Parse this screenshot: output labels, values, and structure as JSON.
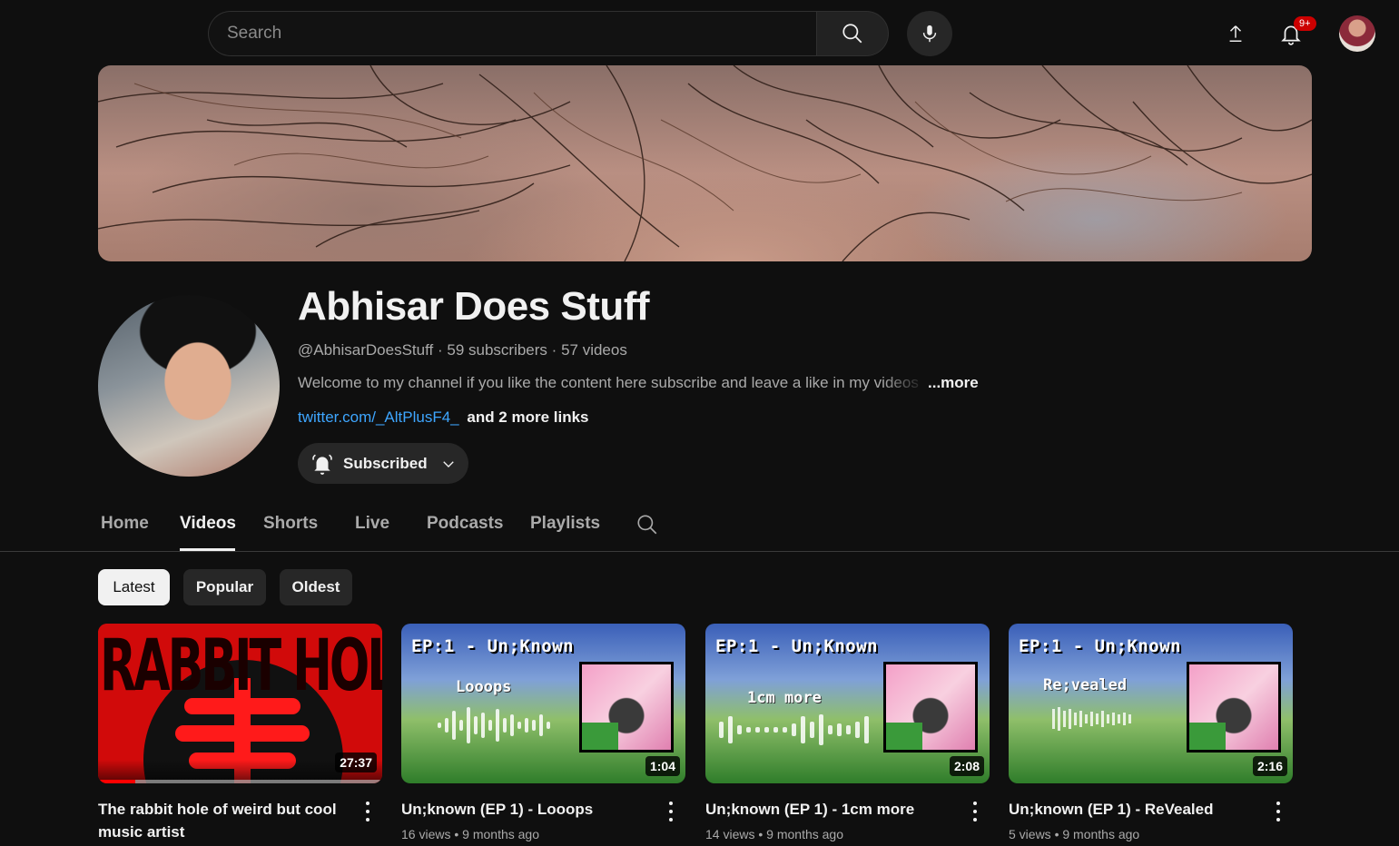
{
  "header": {
    "search_placeholder": "Search",
    "icons": [
      "search-icon",
      "mic-icon",
      "upload-icon",
      "bell-icon",
      "account-avatar"
    ],
    "notification_badge": "9+"
  },
  "channel": {
    "name": "Abhisar Does Stuff",
    "handle": "@AbhisarDoesStuff",
    "subscribers": "59 subscribers",
    "videos": "57 videos",
    "description": "Welcome to my channel if you like the content here subscribe and leave a like in my videos",
    "more_label": "...more",
    "link": "twitter.com/_AltPlusF4_",
    "more_links": "and 2 more links",
    "subscribe_label": "Subscribed"
  },
  "tabs": [
    {
      "label": "Home"
    },
    {
      "label": "Videos",
      "active": true
    },
    {
      "label": "Shorts"
    },
    {
      "label": "Live"
    },
    {
      "label": "Podcasts"
    },
    {
      "label": "Playlists"
    }
  ],
  "chips": [
    {
      "label": "Latest",
      "active": true
    },
    {
      "label": "Popular"
    },
    {
      "label": "Oldest"
    }
  ],
  "videos": [
    {
      "title": "The rabbit hole of weird but cool music artist",
      "views": "",
      "age": "",
      "duration": "27:37",
      "thumb_text": "RABBIT HOLE",
      "watched_fraction": 0.13
    },
    {
      "title": "Un;known (EP 1) - Looops",
      "views": "16 views",
      "age": "9 months ago",
      "duration": "1:04",
      "thumb_header": "EP:1 - Un;Known",
      "thumb_track": "Looops"
    },
    {
      "title": "Un;known (EP 1) - 1cm more",
      "views": "14 views",
      "age": "9 months ago",
      "duration": "2:08",
      "thumb_header": "EP:1 - Un;Known",
      "thumb_track": "1cm more"
    },
    {
      "title": "Un;known (EP 1) - ReVealed",
      "views": "5 views",
      "age": "9 months ago",
      "duration": "2:16",
      "thumb_header": "EP:1 - Un;Known",
      "thumb_track": "Re;vealed"
    }
  ],
  "colors": {
    "background": "#0f0f0f",
    "link": "#3ea6ff",
    "badge": "#cc0000",
    "progress": "#ff0000"
  }
}
